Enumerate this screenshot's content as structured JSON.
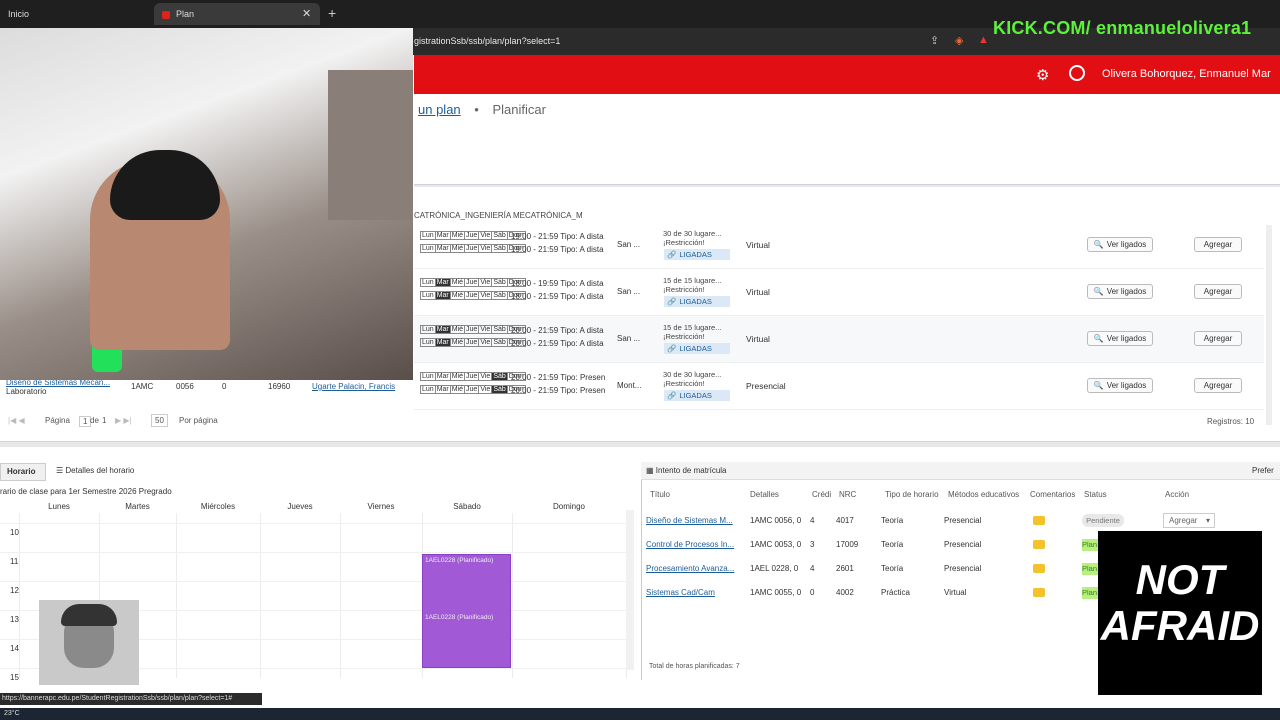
{
  "browser": {
    "tabs": [
      {
        "label": "Inicio"
      },
      {
        "label": "Plan"
      }
    ],
    "url": "gistrationSsb/ssb/plan/plan?select=1",
    "status_url": "https://bannerapc.edu.pe/StudentRegistrationSsb/ssb/plan/plan?select=1#"
  },
  "overlay": {
    "kick": "KICK.COM/ enmanuelolivera1",
    "not_afraid": [
      "NOT",
      "AFRAID"
    ]
  },
  "header": {
    "username": "Olivera Bohorquez, Enmanuel Mar",
    "breadcrumbs": [
      "un plan",
      "Planificar"
    ]
  },
  "program": "CATRÓNICA_INGENIERÍA MECATRÓNICA_M",
  "sections": [
    {
      "time1": "19:00 - 21:59 Tipo: A dista",
      "time2": "19:00 - 21:59 Tipo: A dista",
      "campus": "San ...",
      "seats": "30 de 30 lugare...",
      "restr": "¡Restricción!",
      "linked": "LIGADAS",
      "mode": "Virtual",
      "on": []
    },
    {
      "time1": "18:00 - 19:59 Tipo: A dista",
      "time2": "18:00 - 21:59 Tipo: A dista",
      "campus": "San ...",
      "seats": "15 de 15 lugare...",
      "restr": "¡Restricción!",
      "linked": "LIGADAS",
      "mode": "Virtual",
      "on": [
        1
      ]
    },
    {
      "time1": "20:00 - 21:59 Tipo: A dista",
      "time2": "20:00 - 21:59 Tipo: A dista",
      "campus": "San ...",
      "seats": "15 de 15 lugare...",
      "restr": "¡Restricción!",
      "linked": "LIGADAS",
      "mode": "Virtual",
      "on": [
        1
      ]
    },
    {
      "time1": "20:00 - 21:59 Tipo: Presen",
      "time2": "20:00 - 21:59 Tipo: Presen",
      "campus": "Mont...",
      "seats": "30 de 30 lugare...",
      "restr": "¡Restricción!",
      "linked": "LIGADAS",
      "mode": "Presencial",
      "on": [
        5
      ]
    }
  ],
  "day_abbrevs": [
    "Lun",
    "Mar",
    "Mié",
    "Jue",
    "Vie",
    "Sáb",
    "Dom"
  ],
  "row4_left": {
    "title": "Diseño de Sistemas Mecan...",
    "subtitle": "Laboratorio",
    "subject": "1AMC",
    "course": "0056",
    "credits": "0",
    "nrc": "16960",
    "instructor": "Ugarte Palacin, Francis"
  },
  "buttons": {
    "ver_ligados": "Ver ligados",
    "agregar": "Agregar"
  },
  "pager": {
    "pagina": "Página",
    "page": "1",
    "de": "de",
    "total": "1",
    "per_page": "50",
    "por_pagina": "Por página",
    "registros": "Registros: 10"
  },
  "calendar": {
    "tab_horario": "Horario",
    "tab_detalles": "Detalles del horario",
    "title": "rario de clase para 1er Semestre 2026 Pregrado",
    "days": [
      "Lunes",
      "Martes",
      "Miércoles",
      "Jueves",
      "Viernes",
      "Sábado",
      "Domingo"
    ],
    "hours": [
      "10",
      "11",
      "12",
      "13",
      "14",
      "15"
    ],
    "block_label_1": "1AEL0228 (Planificado)",
    "block_label_2": "1AEL0228 (Planificado)"
  },
  "matricula": {
    "title": "Intento de matrícula",
    "right_label": "Prefer",
    "headers": [
      "Título",
      "Detalles",
      "Crédi",
      "NRC",
      "Tipo de horario",
      "Métodos educativos",
      "Comentarios",
      "Status",
      "Acción"
    ],
    "rows": [
      {
        "title": "Diseño de Sistemas M...",
        "details": "1AMC 0056, 0",
        "credits": "4",
        "nrc": "4017",
        "type": "Teoría",
        "method": "Presencial",
        "status": "Pendiente"
      },
      {
        "title": "Control de Procesos In...",
        "details": "1AMC 0053, 0",
        "credits": "3",
        "nrc": "17009",
        "type": "Teoría",
        "method": "Presencial",
        "status": "Plan"
      },
      {
        "title": "Procesamiento Avanza...",
        "details": "1AEL 0228, 0",
        "credits": "4",
        "nrc": "2601",
        "type": "Teoría",
        "method": "Presencial",
        "status": "Plan"
      },
      {
        "title": "Sistemas Cad/Cam",
        "details": "1AMC 0055, 0",
        "credits": "0",
        "nrc": "4002",
        "type": "Práctica",
        "method": "Virtual",
        "status": "Plan"
      }
    ],
    "action_label": "Agregar",
    "total_hours": "Total de horas planificadas: 7"
  },
  "taskbar": {
    "temp": "23°C"
  },
  "colors": {
    "header_red": "#e10f14",
    "kick_green": "#5cf23c",
    "block_purple": "#a259d6",
    "link_blue": "#1c5d99"
  }
}
